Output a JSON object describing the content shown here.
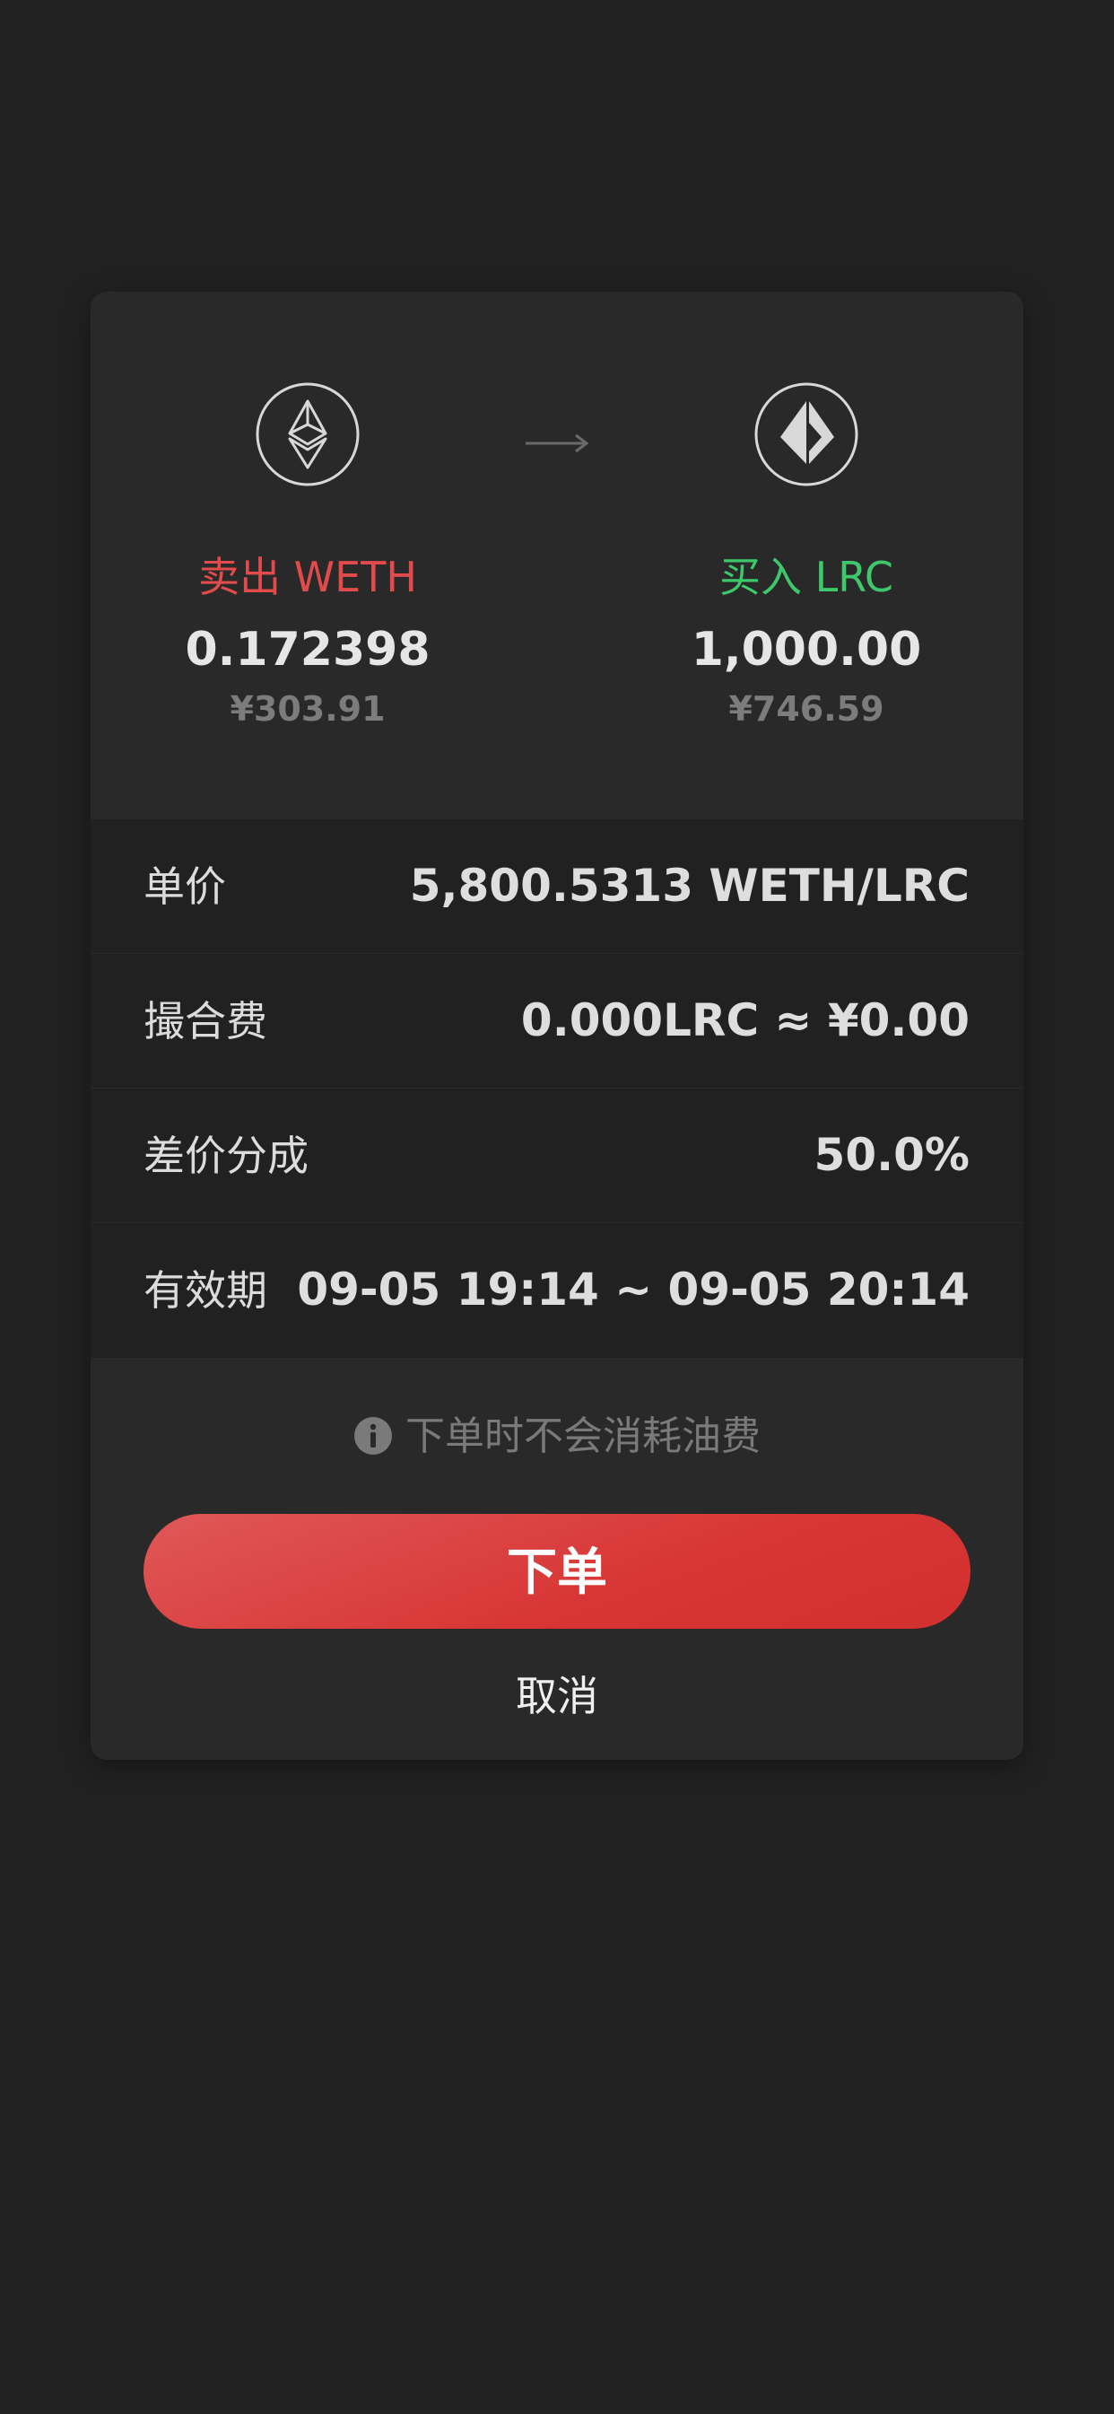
{
  "sell": {
    "icon": "ethereum-icon",
    "action_label": "卖出 WETH",
    "amount": "0.172398",
    "fiat": "¥303.91"
  },
  "buy": {
    "icon": "loopring-icon",
    "action_label": "买入 LRC",
    "amount": "1,000.00",
    "fiat": "¥746.59"
  },
  "details": [
    {
      "label": "单价",
      "value": "5,800.5313 WETH/LRC"
    },
    {
      "label": "撮合费",
      "value": "0.000LRC ≈ ¥0.00"
    },
    {
      "label": "差价分成",
      "value": "50.0%"
    },
    {
      "label": "有效期",
      "value": "09-05 19:14 ~ 09-05 20:14"
    }
  ],
  "notice": "下单时不会消耗油费",
  "submit_label": "下单",
  "cancel_label": "取消",
  "colors": {
    "sell": "#e14b4b",
    "buy": "#3dc86a",
    "button": "#d83535"
  }
}
